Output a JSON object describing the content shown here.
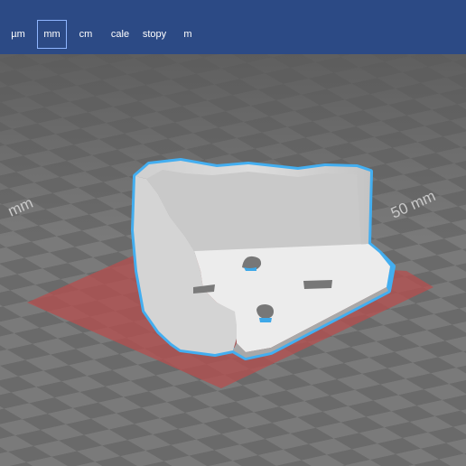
{
  "units": {
    "items": [
      {
        "label": "µm",
        "selected": false
      },
      {
        "label": "mm",
        "selected": true
      },
      {
        "label": "cm",
        "selected": false
      },
      {
        "label": "cale",
        "selected": false
      },
      {
        "label": "stopy",
        "selected": false
      },
      {
        "label": "m",
        "selected": false
      }
    ]
  },
  "viewport": {
    "left_axis_label": "mm",
    "right_axis_label": "50 mm"
  },
  "colors": {
    "toolbar": "#2c4a85",
    "grid_dark": "#5f5f5f",
    "grid_light": "#767676",
    "build_area": "#b04848",
    "model": "#e9e9e9",
    "outline": "#3ea8e8"
  }
}
